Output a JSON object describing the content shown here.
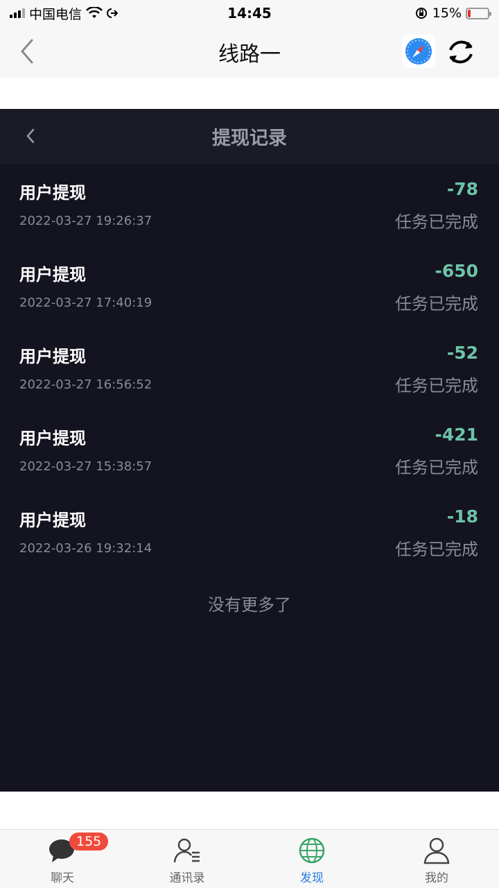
{
  "status_bar": {
    "carrier": "中国电信",
    "time": "14:45",
    "battery_percent": "15%",
    "battery_level": 0.15
  },
  "nav": {
    "title": "线路一"
  },
  "app": {
    "title": "提现记录",
    "records": [
      {
        "type": "用户提现",
        "time": "2022-03-27 19:26:37",
        "amount": "-78",
        "status": "任务已完成"
      },
      {
        "type": "用户提现",
        "time": "2022-03-27 17:40:19",
        "amount": "-650",
        "status": "任务已完成"
      },
      {
        "type": "用户提现",
        "time": "2022-03-27 16:56:52",
        "amount": "-52",
        "status": "任务已完成"
      },
      {
        "type": "用户提现",
        "time": "2022-03-27 15:38:57",
        "amount": "-421",
        "status": "任务已完成"
      },
      {
        "type": "用户提现",
        "time": "2022-03-26 19:32:14",
        "amount": "-18",
        "status": "任务已完成"
      }
    ],
    "no_more": "没有更多了"
  },
  "tabs": [
    {
      "label": "聊天",
      "icon": "chat-bubble-icon",
      "badge": "155"
    },
    {
      "label": "通讯录",
      "icon": "contacts-icon"
    },
    {
      "label": "发现",
      "icon": "globe-icon",
      "active": true
    },
    {
      "label": "我的",
      "icon": "person-icon"
    }
  ],
  "colors": {
    "accent": "#2a7de1",
    "amount": "#6fc3a8",
    "dark_bg": "#13141f",
    "badge": "#f04a3d"
  }
}
